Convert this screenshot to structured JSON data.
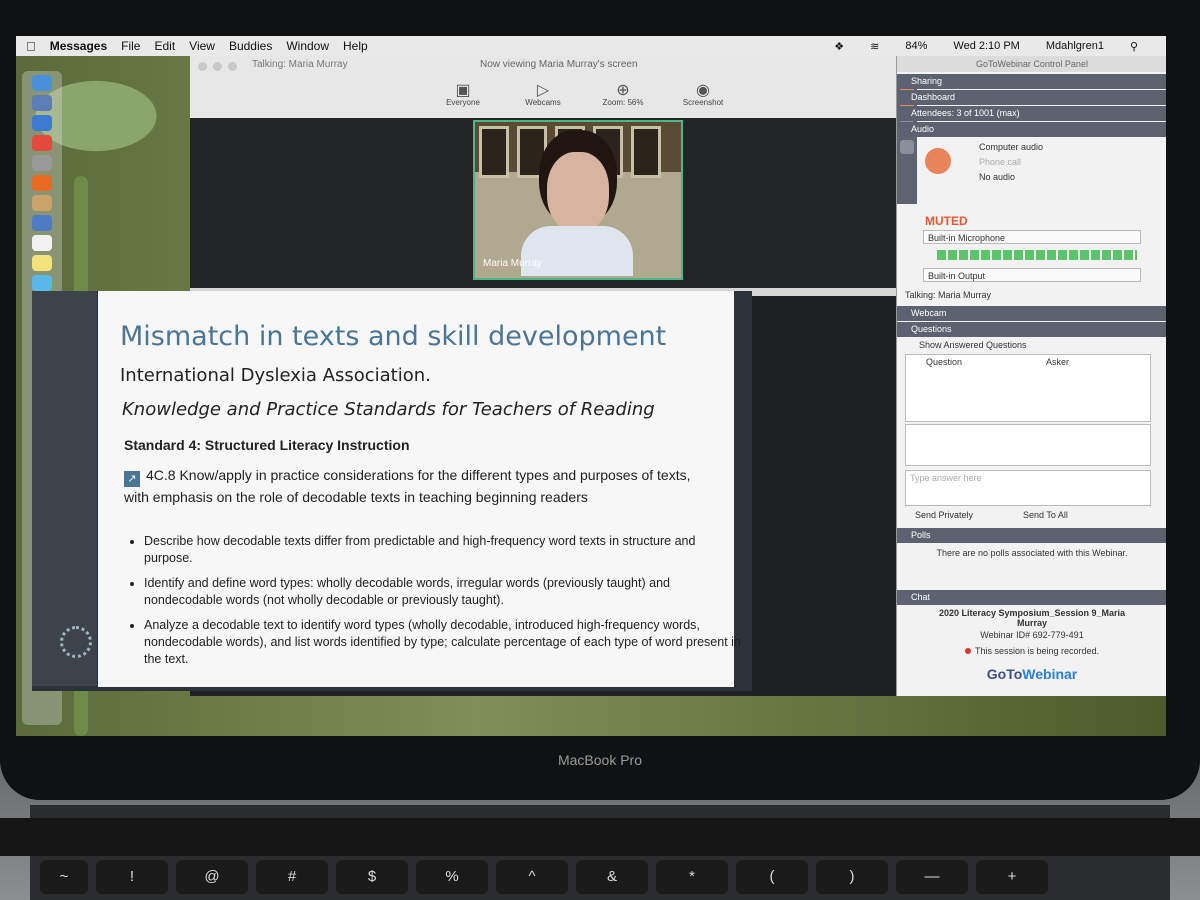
{
  "menubar": {
    "app_name": "Messages",
    "items": [
      "File",
      "Edit",
      "View",
      "Buddies",
      "Window",
      "Help"
    ],
    "battery": "84%",
    "clock": "Wed 2:10 PM",
    "user": "Mdahlgren1"
  },
  "viewer": {
    "talking_title": "Talking: Maria Murray",
    "viewing_title": "Now viewing Maria Murray's screen",
    "tools": [
      {
        "label": "Everyone",
        "icon": "person-icon"
      },
      {
        "label": "Webcams",
        "icon": "camera-icon"
      },
      {
        "label": "Zoom: 56%",
        "icon": "zoom-icon"
      },
      {
        "label": "Screenshot",
        "icon": "screenshot-icon"
      }
    ],
    "webcam_name": "Maria Murray"
  },
  "slide": {
    "title": "Mismatch in texts and skill development",
    "subtitle": "International Dyslexia Association.",
    "subtitle2": "Knowledge and Practice Standards for Teachers of Reading",
    "standard": "Standard 4: Structured Literacy Instruction",
    "body": "4C.8 Know/apply in practice considerations for the different types and purposes of texts, with emphasis on the role of decodable texts in teaching beginning readers",
    "bullets": [
      "Describe how decodable texts differ from predictable and high-frequency word texts in structure and purpose.",
      "Identify and define word types: wholly decodable words, irregular words (previously taught) and nondecodable words (not wholly decodable or previously taught).",
      "Analyze a decodable text to identify word types (wholly decodable, introduced high-frequency words, nondecodable words), and list words identified by type; calculate percentage of each type of word present in the text."
    ]
  },
  "panel": {
    "title": "GoToWebinar Control Panel",
    "sections": {
      "sharing": "Sharing",
      "dashboard": "Dashboard",
      "attendees": "Attendees: 3 of 1001 (max)",
      "audio": "Audio",
      "webcam": "Webcam",
      "questions": "Questions",
      "polls": "Polls",
      "chat": "Chat"
    },
    "audio_options": [
      "Computer audio",
      "Phone call",
      "No audio"
    ],
    "muted": "MUTED",
    "microphone": "Built-in Microphone",
    "output": "Built-in Output",
    "talking": "Talking: Maria Murray",
    "show_answered": "Show Answered Questions",
    "col_question": "Question",
    "col_asker": "Asker",
    "answer_placeholder": "Type answer here",
    "send_privately": "Send Privately",
    "send_to_all": "Send To All",
    "polls_text": "There are no polls associated with this Webinar.",
    "session_name": "2020 Literacy Symposium_Session 9_Maria Murray",
    "webinar_id": "Webinar ID# 692-779-491",
    "recording": "This session is being recorded.",
    "brand_a": "GoTo",
    "brand_b": "Webinar"
  },
  "laptop": {
    "model": "MacBook Pro",
    "keys": [
      "~",
      "!",
      "@",
      "#",
      "$",
      "%",
      "^",
      "&",
      "*",
      "(",
      ")",
      "—",
      "+"
    ]
  }
}
